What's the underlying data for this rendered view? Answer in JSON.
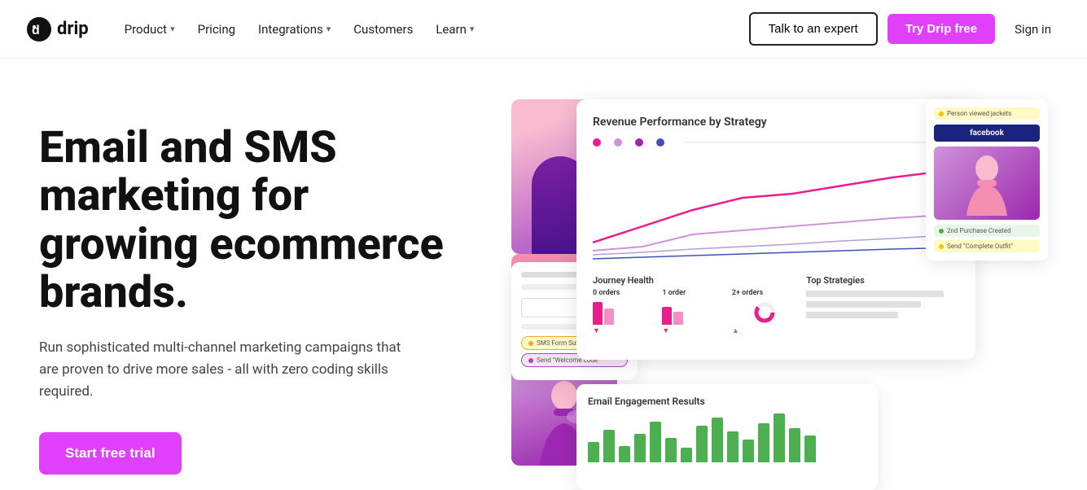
{
  "nav": {
    "logo_text": "drip",
    "items": [
      {
        "label": "Product",
        "has_dropdown": true
      },
      {
        "label": "Pricing",
        "has_dropdown": false
      },
      {
        "label": "Integrations",
        "has_dropdown": true
      },
      {
        "label": "Customers",
        "has_dropdown": false
      },
      {
        "label": "Learn",
        "has_dropdown": true
      }
    ],
    "btn_expert": "Talk to an expert",
    "btn_try": "Try Drip free",
    "btn_signin": "Sign in"
  },
  "hero": {
    "heading": "Email and SMS marketing for growing ecommerce brands.",
    "subtext": "Run sophisticated multi-channel marketing campaigns that are proven to drive more sales - all with zero coding skills required.",
    "btn_start": "Start free trial"
  },
  "dashboard": {
    "revenue_title": "Revenue Performance by Strategy",
    "journey_title": "Journey Health",
    "top_strat_title": "Top Strategies",
    "orders_0": "0 orders",
    "orders_1": "1 order",
    "orders_2": "2+ orders",
    "email_title": "Email Engagement Results",
    "sms_badge": "SMS Form Submitted",
    "welcome_badge": "Send \"Welcome code\"",
    "person_viewed": "Person viewed jackets",
    "facebook_label": "facebook",
    "purchase_badge": "2nd Purchase Created",
    "send_outfit_badge": "Send \"Complete Outfit\""
  },
  "colors": {
    "brand_pink": "#e040fb",
    "chart_pink": "#e91e8c",
    "chart_lavender": "#9c27b0",
    "chart_blue": "#3f51b5",
    "chart_light": "#ce93d8",
    "green": "#4caf50",
    "yellow": "#ffc107"
  }
}
